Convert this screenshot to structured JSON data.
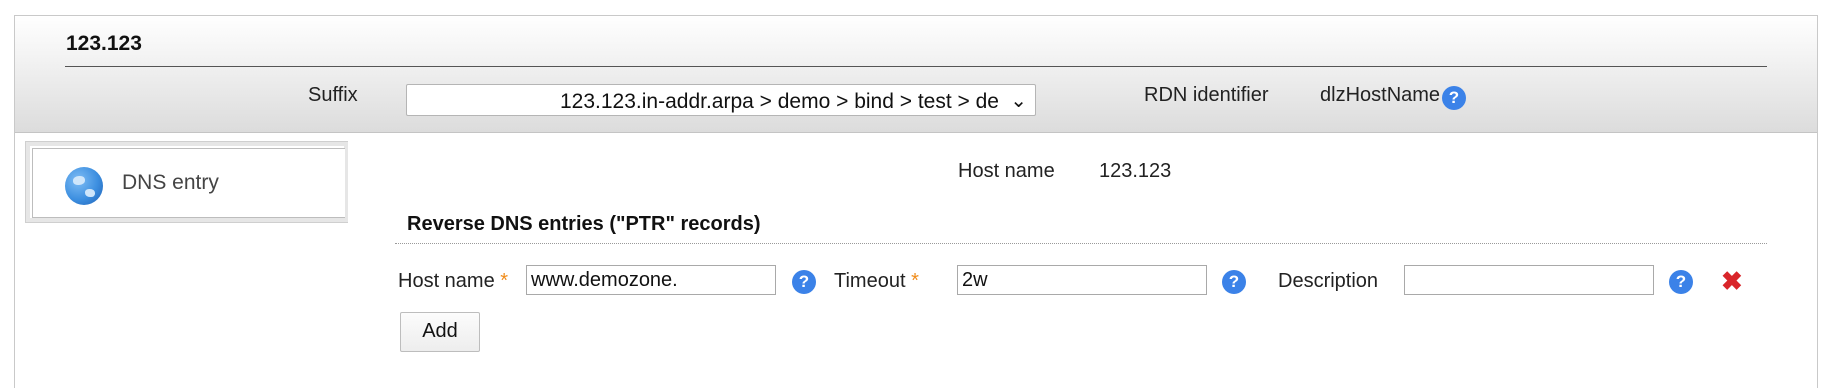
{
  "header": {
    "title": "123.123",
    "suffix_label": "Suffix",
    "suffix_value": "123.123.in-addr.arpa > demo > bind > test > de",
    "rdn_label": "RDN identifier",
    "rdn_value": "dlzHostName"
  },
  "sidebar": {
    "tab_label": "DNS entry",
    "tab_icon": "globe-icon"
  },
  "main": {
    "hostname_label": "Host name",
    "hostname_value": "123.123",
    "section_title": "Reverse DNS entries (\"PTR\" records)",
    "record": {
      "host_label": "Host name",
      "host_value": "www.demozone.",
      "timeout_label": "Timeout",
      "timeout_value": "2w",
      "description_label": "Description",
      "description_value": ""
    },
    "required_marker": "*",
    "help_glyph": "?",
    "remove_glyph": "✖",
    "add_label": "Add"
  },
  "colors": {
    "help_blue": "#3b82e8",
    "required_orange": "#f08c1a",
    "remove_red": "#d9252a"
  }
}
